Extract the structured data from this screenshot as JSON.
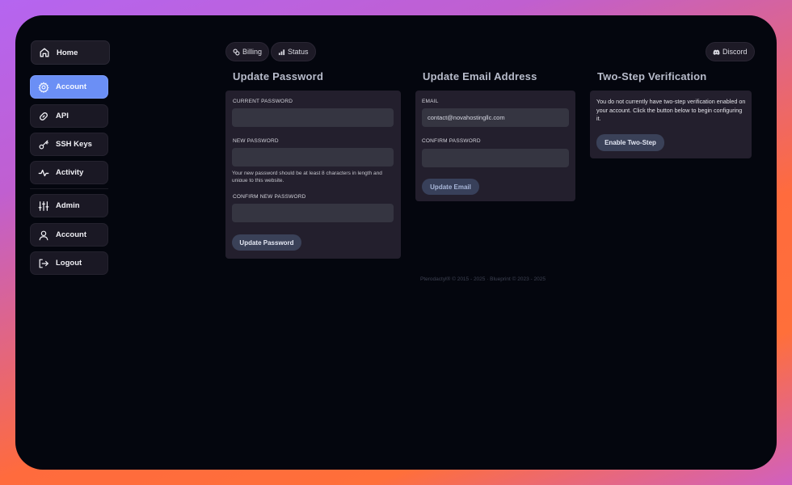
{
  "sidebar": {
    "home": "Home",
    "account": "Account",
    "api": "API",
    "ssh_keys": "SSH Keys",
    "activity": "Activity",
    "admin": "Admin",
    "account2": "Account",
    "logout": "Logout"
  },
  "topbar": {
    "billing": "Billing",
    "status": "Status",
    "discord": "Discord"
  },
  "password": {
    "title": "Update Password",
    "current_label": "CURRENT PASSWORD",
    "new_label": "NEW PASSWORD",
    "hint": "Your new password should be at least 8 characters in length and unique to this website.",
    "confirm_label": "CONFIRM NEW PASSWORD",
    "button": "Update Password"
  },
  "email": {
    "title": "Update Email Address",
    "email_label": "EMAIL",
    "email_value": "contact@novahostingllc.com",
    "confirm_label": "CONFIRM PASSWORD",
    "button": "Update Email"
  },
  "twostep": {
    "title": "Two-Step Verification",
    "description": "You do not currently have two-step verification enabled on your account. Click the button below to begin configuring it.",
    "button": "Enable Two-Step"
  },
  "footer": {
    "text": "Pterodactyl® © 2015 - 2025  ·  Blueprint © 2023 - 2025"
  },
  "colors": {
    "accent": "#6b8ff5",
    "panel": "#231f2d",
    "background": "#04060e"
  }
}
